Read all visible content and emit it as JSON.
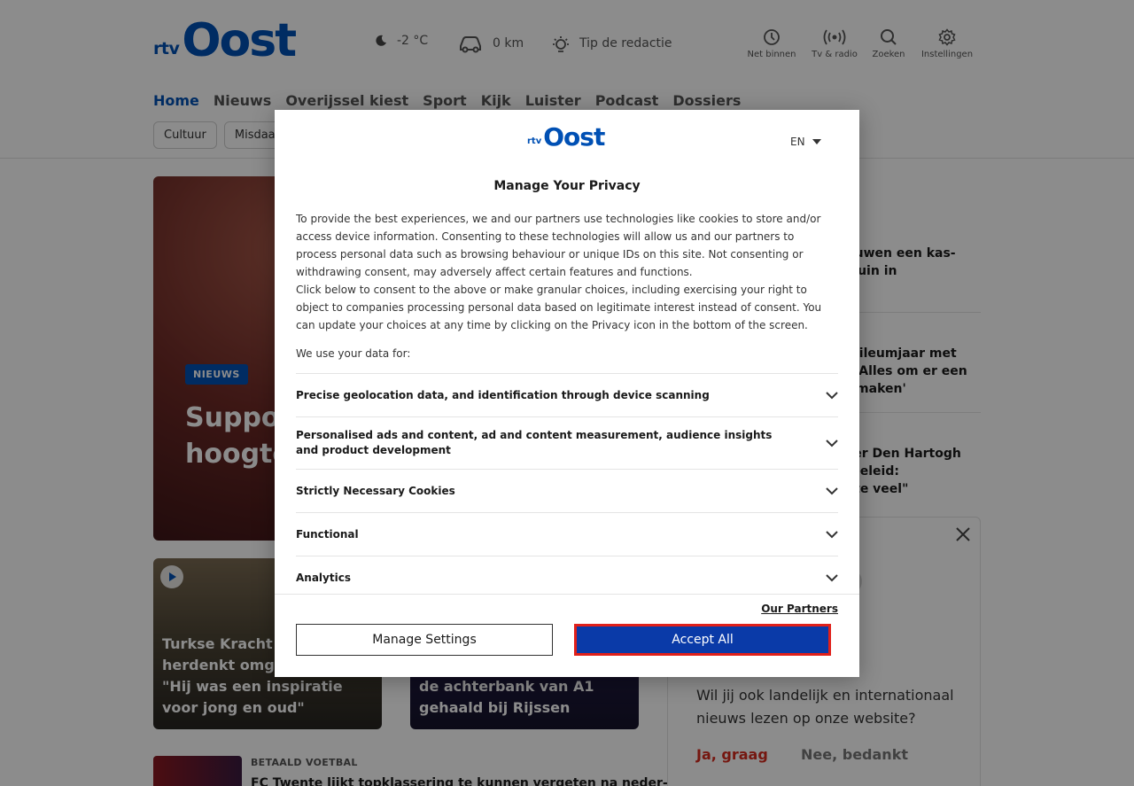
{
  "header": {
    "logo": {
      "rtv": "rtv",
      "oost": "Oost"
    },
    "weather": {
      "temperature": "-2 °C",
      "traffic": "0 km",
      "tip": "Tip de redactie"
    },
    "tools": [
      {
        "label": "Net binnen",
        "icon": "clock-icon"
      },
      {
        "label": "Tv & radio",
        "icon": "broadcast-icon"
      },
      {
        "label": "Zoeken",
        "icon": "search-icon"
      },
      {
        "label": "Instellingen",
        "icon": "gear-icon"
      }
    ],
    "nav": [
      "Home",
      "Nieuws",
      "Overijssel kiest",
      "Sport",
      "Kijk",
      "Luister",
      "Podcast",
      "Dossiers"
    ],
    "subnav": [
      "Cultuur",
      "Misdaad"
    ]
  },
  "hero": {
    "badge": "NIEUWS",
    "title": "Supporters bekogelen hoogte"
  },
  "cards": [
    {
      "title": "Turkse Kracht uit herdenkt omgeko Furkan: \"Hij was een inspiratie voor jong en oud\""
    },
    {
      "title": "de achterbank van A1 gehaald bij Rijssen"
    }
  ],
  "list_row": {
    "category": "BETAALD VOETBAL",
    "title": "FC Twente lijkt topklassering te kunnen vergeten na neder-"
  },
  "sidebar": {
    "heading": "u",
    "items": [
      "bouwen een kas-\nertuin in",
      "jubileumjaar met\ne: 'Alles om er een\nte maken'",
      "kker Den Hartogh\nofbeleid:\nal te veel\""
    ]
  },
  "promo": {
    "big": "S",
    "question": "?",
    "text": "Wil jij ook landelijk en internationaal nieuws lezen op onze website?",
    "yes": "Ja, graag",
    "no": "Nee, bedankt"
  },
  "modal": {
    "logo": {
      "rtv": "rtv",
      "oost": "Oost"
    },
    "language": "EN",
    "title": "Manage Your Privacy",
    "paragraph1": "To provide the best experiences, we and our partners use technologies like cookies to store and/or access device information. Consenting to these technologies will allow us and our partners to process personal data such as browsing behaviour or unique IDs on this site. Not consenting or withdrawing consent, may adversely affect certain features and functions.",
    "paragraph2": "Click below to consent to the above or make granular choices, including exercising your right to object to companies processing personal data based on legitimate interest instead of consent. You can update your choices at any time by clicking on the Privacy icon in the bottom of the screen.",
    "uses_label": "We use your data for:",
    "purposes": [
      "Precise geolocation data, and identification through device scanning",
      "Personalised ads and content, ad and content measurement, audience insights and product development",
      "Strictly Necessary Cookies",
      "Functional",
      "Analytics"
    ],
    "partners_link": "Our Partners",
    "manage_button": "Manage Settings",
    "accept_button": "Accept All"
  },
  "colors": {
    "brand_blue": "#0050b4",
    "accept_blue": "#0a3aa8",
    "highlight_red": "#e0201a"
  }
}
